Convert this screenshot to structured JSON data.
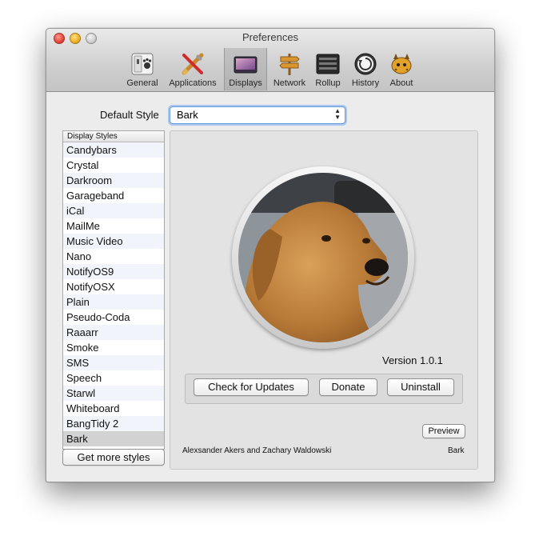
{
  "window": {
    "title": "Preferences"
  },
  "toolbar": [
    {
      "label": "General",
      "icon": "general-icon"
    },
    {
      "label": "Applications",
      "icon": "applications-icon"
    },
    {
      "label": "Displays",
      "icon": "displays-icon",
      "selected": true
    },
    {
      "label": "Network",
      "icon": "network-icon"
    },
    {
      "label": "Rollup",
      "icon": "rollup-icon"
    },
    {
      "label": "History",
      "icon": "history-icon"
    },
    {
      "label": "About",
      "icon": "about-icon"
    }
  ],
  "default_style": {
    "label": "Default Style",
    "value": "Bark"
  },
  "style_list": {
    "header": "Display Styles",
    "items": [
      "Candybars",
      "Crystal",
      "Darkroom",
      "Garageband",
      "iCal",
      "MailMe",
      "Music Video",
      "Nano",
      "NotifyOS9",
      "NotifyOSX",
      "Plain",
      "Pseudo-Coda",
      "Raaarr",
      "Smoke",
      "SMS",
      "Speech",
      "Starwl",
      "Whiteboard",
      "BangTidy 2",
      "Bark"
    ],
    "selected": "Bark",
    "more_button": "Get more styles"
  },
  "detail": {
    "version": "Version 1.0.1",
    "check_updates": "Check for Updates",
    "donate": "Donate",
    "uninstall": "Uninstall",
    "preview": "Preview",
    "authors": "Alexsander Akers and Zachary Waldowski",
    "style_name": "Bark",
    "image": "golden-retriever-photo"
  }
}
